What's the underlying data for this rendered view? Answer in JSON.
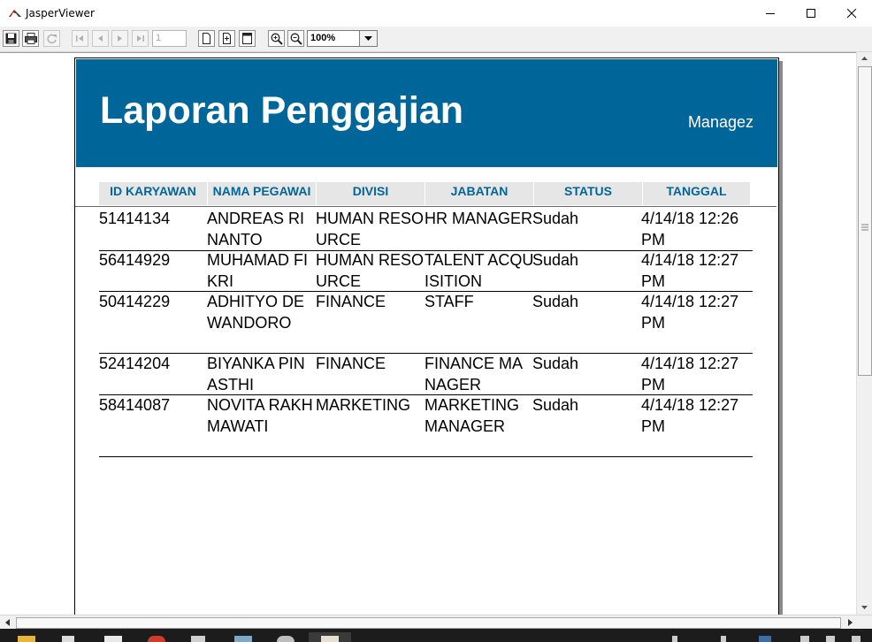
{
  "window": {
    "title": "JasperViewer"
  },
  "toolbar": {
    "page_number": "1",
    "zoom": "100%"
  },
  "report": {
    "title": "Laporan Penggajian",
    "org": "Managez",
    "columns": [
      "ID KARYAWAN",
      "NAMA PEGAWAI",
      "DIVISI",
      "JABATAN",
      "STATUS",
      "TANGGAL"
    ],
    "rows": [
      [
        "51414134",
        "ANDREAS RINANTO",
        "HUMAN RESOURCE",
        "HR MANAGER",
        "Sudah",
        "4/14/18 12:26 PM"
      ],
      [
        "56414929",
        "MUHAMAD FIKRI",
        "HUMAN RESOURCE",
        "TALENT ACQUISITION",
        "Sudah",
        "4/14/18 12:27 PM"
      ],
      [
        "50414229",
        "ADHITYO DEWANDORO",
        "FINANCE",
        "STAFF",
        "Sudah",
        "4/14/18 12:27 PM"
      ],
      [
        "52414204",
        "BIYANKA PINASTHI",
        "FINANCE",
        "FINANCE MANAGER",
        "Sudah",
        "4/14/18 12:27 PM"
      ],
      [
        "58414087",
        "NOVITA RAKHMAWATI",
        "MARKETING",
        "MARKETING MANAGER",
        "Sudah",
        "4/14/18 12:27 PM"
      ]
    ]
  },
  "colors": {
    "banner": "#006699",
    "header_text": "#006699",
    "header_bg": "#e6e6e6"
  }
}
